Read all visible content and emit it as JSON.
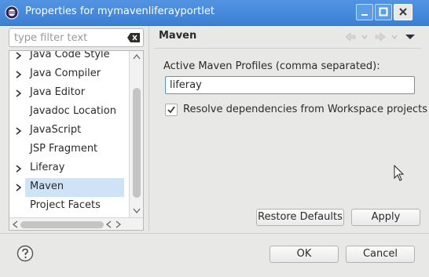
{
  "window": {
    "title": "Properties for mymavenliferayportlet",
    "icon": "eclipse-icon"
  },
  "filter": {
    "placeholder": "type filter text",
    "icon": "clear-filter-icon"
  },
  "tree": {
    "items": [
      {
        "label": "Java Code Style",
        "expandable": true,
        "selected": false
      },
      {
        "label": "Java Compiler",
        "expandable": true,
        "selected": false
      },
      {
        "label": "Java Editor",
        "expandable": true,
        "selected": false
      },
      {
        "label": "Javadoc Location",
        "expandable": false,
        "selected": false
      },
      {
        "label": "JavaScript",
        "expandable": true,
        "selected": false
      },
      {
        "label": "JSP Fragment",
        "expandable": false,
        "selected": false
      },
      {
        "label": "Liferay",
        "expandable": true,
        "selected": false
      },
      {
        "label": "Maven",
        "expandable": true,
        "selected": true
      },
      {
        "label": "Project Facets",
        "expandable": false,
        "selected": false
      }
    ]
  },
  "page": {
    "title": "Maven",
    "profiles_label": "Active Maven Profiles (comma separated):",
    "profiles_value": "liferay",
    "resolve_label": "Resolve dependencies from Workspace projects",
    "resolve_checked": true
  },
  "buttons": {
    "restore": "Restore Defaults",
    "apply": "Apply",
    "ok": "OK",
    "cancel": "Cancel"
  },
  "colors": {
    "titlebar": "#4a8ddc",
    "selection": "#cfe3f7",
    "focus": "#5294e2"
  }
}
